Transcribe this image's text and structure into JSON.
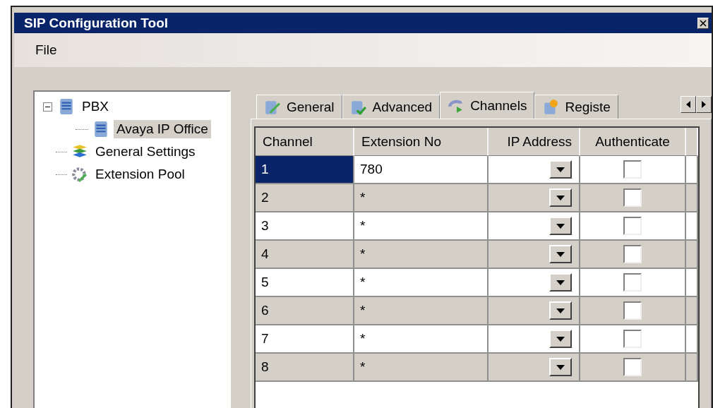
{
  "window": {
    "title": "SIP Configuration Tool"
  },
  "menu": [
    "File"
  ],
  "tree": [
    {
      "label": "PBX",
      "kind": "server",
      "expanded": true,
      "selected": false,
      "children": [
        {
          "label": "Avaya IP Office",
          "kind": "server",
          "selected": true
        }
      ]
    },
    {
      "label": "General Settings",
      "kind": "books",
      "selected": false
    },
    {
      "label": "Extension Pool",
      "kind": "gear",
      "selected": false
    }
  ],
  "tabs": [
    {
      "label": "General",
      "kind": "edit",
      "selected": false
    },
    {
      "label": "Advanced",
      "kind": "check",
      "selected": false
    },
    {
      "label": "Channels",
      "kind": "phone",
      "selected": true
    },
    {
      "label": "Registe",
      "kind": "star",
      "selected": false
    }
  ],
  "table": {
    "columns": [
      "Channel",
      "Extension No",
      "IP Address",
      "Authenticate"
    ],
    "rows": [
      {
        "channel": "1",
        "extension": "780",
        "authenticate": false,
        "selected": true
      },
      {
        "channel": "2",
        "extension": "*",
        "authenticate": false,
        "selected": false
      },
      {
        "channel": "3",
        "extension": "*",
        "authenticate": false,
        "selected": false
      },
      {
        "channel": "4",
        "extension": "*",
        "authenticate": false,
        "selected": false
      },
      {
        "channel": "5",
        "extension": "*",
        "authenticate": false,
        "selected": false
      },
      {
        "channel": "6",
        "extension": "*",
        "authenticate": false,
        "selected": false
      },
      {
        "channel": "7",
        "extension": "*",
        "authenticate": false,
        "selected": false
      },
      {
        "channel": "8",
        "extension": "*",
        "authenticate": false,
        "selected": false
      }
    ]
  }
}
